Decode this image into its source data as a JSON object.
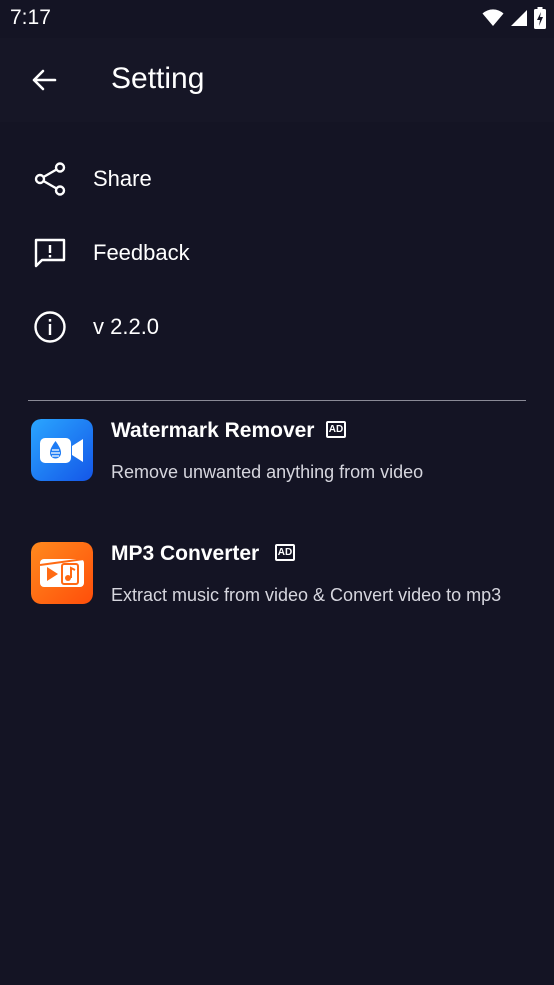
{
  "status_bar": {
    "time": "7:17",
    "icons": [
      "wifi-icon",
      "cell-signal-icon",
      "battery-charging-icon"
    ]
  },
  "header": {
    "back_icon": "arrow-left-icon",
    "title": "Setting"
  },
  "menu": [
    {
      "icon": "share-icon",
      "label": "Share"
    },
    {
      "icon": "feedback-icon",
      "label": "Feedback"
    },
    {
      "icon": "info-icon",
      "label": "v 2.2.0"
    }
  ],
  "promos": [
    {
      "title": "Watermark Remover",
      "badge": "AD",
      "description": "Remove unwanted anything from video",
      "icon": "watermark-remover-app-icon",
      "icon_color": "#1e7cf5"
    },
    {
      "title": "MP3 Converter",
      "badge": "AD",
      "description": "Extract music from video & Convert video to mp3",
      "icon": "mp3-converter-app-icon",
      "icon_color": "#ff6a13"
    }
  ],
  "colors": {
    "background": "#141424",
    "app_bar": "#161626",
    "divider": "#8a8a96"
  }
}
